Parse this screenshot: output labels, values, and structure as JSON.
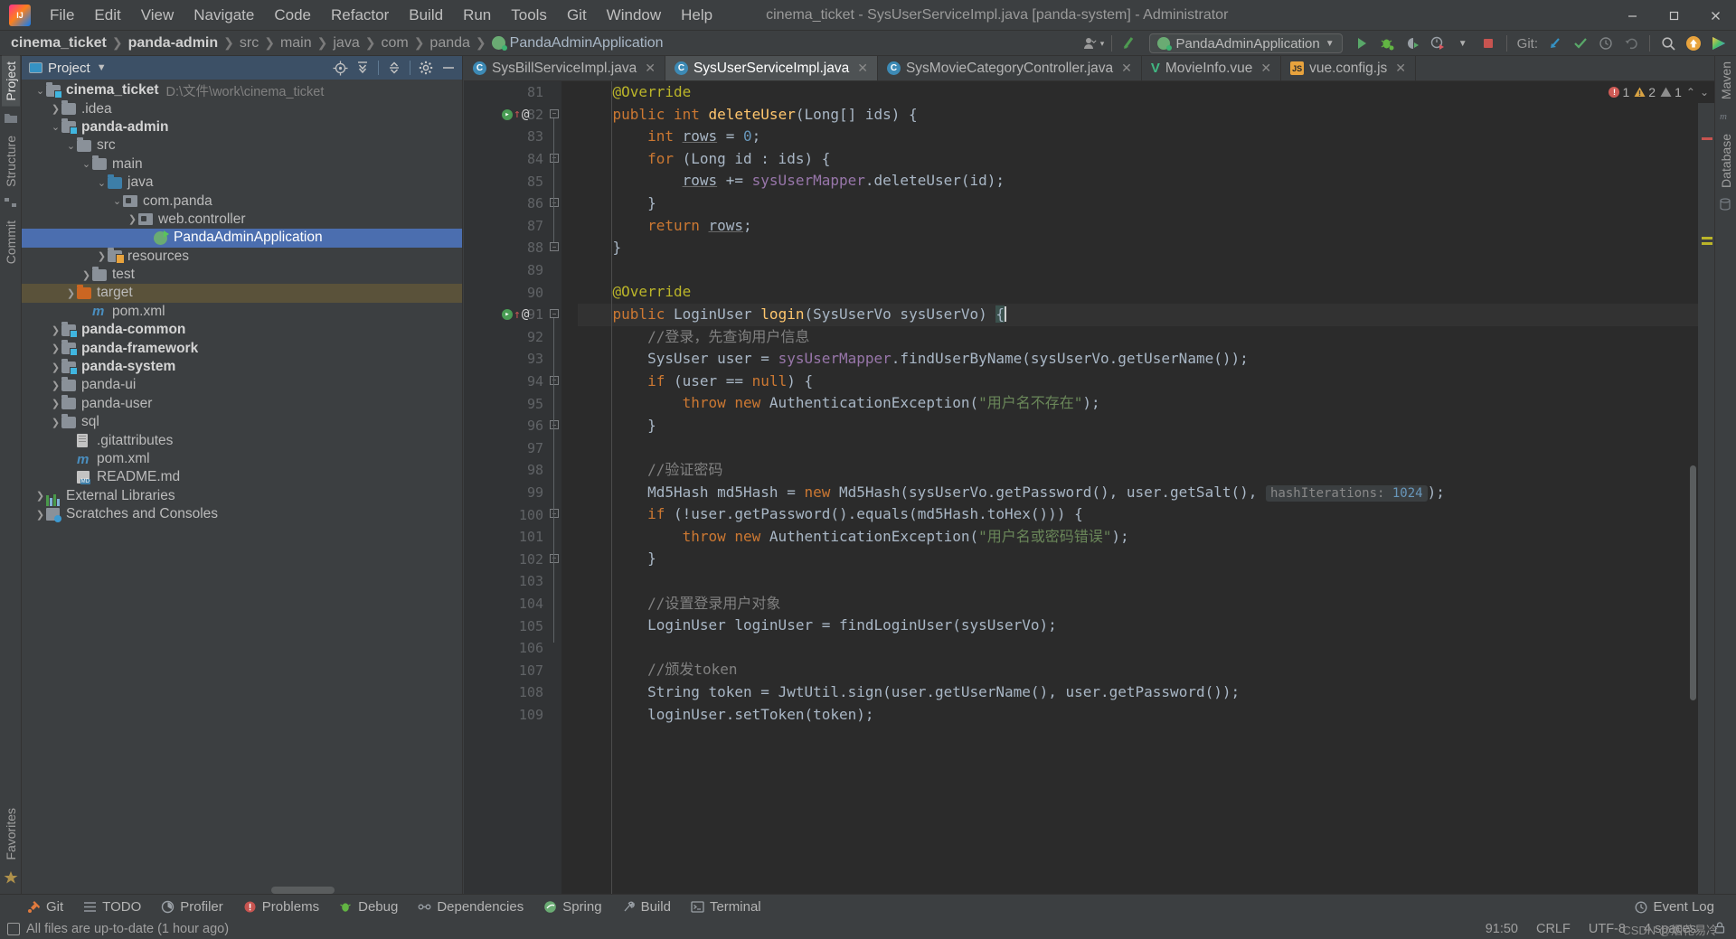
{
  "window": {
    "title": "cinema_ticket - SysUserServiceImpl.java [panda-system] - Administrator",
    "minimize": "—",
    "maximize": "▢",
    "close": "✕"
  },
  "menu": {
    "items": [
      "File",
      "Edit",
      "View",
      "Navigate",
      "Code",
      "Refactor",
      "Build",
      "Run",
      "Tools",
      "Git",
      "Window",
      "Help"
    ]
  },
  "breadcrumb": {
    "items": [
      "cinema_ticket",
      "panda-admin",
      "src",
      "main",
      "java",
      "com",
      "panda",
      "PandaAdminApplication"
    ]
  },
  "toolbar": {
    "run_config": "PandaAdminApplication",
    "git_label": "Git:",
    "icons": [
      "user-icon",
      "updates-icon",
      "run-icon",
      "debug-icon",
      "coverage-icon",
      "profiler-icon",
      "stop-icon",
      "git-pull-icon",
      "git-commit-icon",
      "git-history-icon",
      "git-rollback-icon",
      "search-everywhere-icon",
      "notifications-icon",
      "ide-feature-icon"
    ]
  },
  "left_strip": {
    "tabs": [
      "Project",
      "Structure",
      "Commit"
    ],
    "bottom_tabs": [
      "Favorites"
    ]
  },
  "right_strip": {
    "tabs": [
      "Maven",
      "Database"
    ]
  },
  "project_panel": {
    "title": "Project",
    "actions": [
      "locate-icon",
      "expand-all-icon",
      "collapse-all-icon",
      "settings-gear-icon",
      "hide-icon"
    ],
    "tree": [
      {
        "depth": 0,
        "arrow": "v",
        "icon": "module-folder",
        "label": "cinema_ticket",
        "bold": true,
        "path": "D:\\文件\\work\\cinema_ticket"
      },
      {
        "depth": 1,
        "arrow": ">",
        "icon": "folder",
        "label": ".idea"
      },
      {
        "depth": 1,
        "arrow": "v",
        "icon": "module-folder",
        "label": "panda-admin",
        "bold": true
      },
      {
        "depth": 2,
        "arrow": "v",
        "icon": "folder",
        "label": "src"
      },
      {
        "depth": 3,
        "arrow": "v",
        "icon": "folder",
        "label": "main"
      },
      {
        "depth": 4,
        "arrow": "v",
        "icon": "source-folder",
        "label": "java"
      },
      {
        "depth": 5,
        "arrow": "v",
        "icon": "package",
        "label": "com.panda"
      },
      {
        "depth": 6,
        "arrow": ">",
        "icon": "package",
        "label": "web.controller"
      },
      {
        "depth": 7,
        "arrow": "",
        "icon": "spring-class",
        "label": "PandaAdminApplication",
        "selected": true
      },
      {
        "depth": 4,
        "arrow": ">",
        "icon": "resource-folder",
        "label": "resources"
      },
      {
        "depth": 3,
        "arrow": ">",
        "icon": "folder",
        "label": "test"
      },
      {
        "depth": 2,
        "arrow": ">",
        "icon": "excluded-folder",
        "label": "target",
        "highlight": true
      },
      {
        "depth": 3,
        "arrow": "",
        "icon": "maven",
        "label": "pom.xml"
      },
      {
        "depth": 1,
        "arrow": ">",
        "icon": "module-folder",
        "label": "panda-common",
        "bold": true
      },
      {
        "depth": 1,
        "arrow": ">",
        "icon": "module-folder",
        "label": "panda-framework",
        "bold": true
      },
      {
        "depth": 1,
        "arrow": ">",
        "icon": "module-folder",
        "label": "panda-system",
        "bold": true
      },
      {
        "depth": 1,
        "arrow": ">",
        "icon": "folder",
        "label": "panda-ui"
      },
      {
        "depth": 1,
        "arrow": ">",
        "icon": "folder",
        "label": "panda-user"
      },
      {
        "depth": 1,
        "arrow": ">",
        "icon": "folder",
        "label": "sql"
      },
      {
        "depth": 2,
        "arrow": "",
        "icon": "file",
        "label": ".gitattributes"
      },
      {
        "depth": 2,
        "arrow": "",
        "icon": "maven",
        "label": "pom.xml"
      },
      {
        "depth": 2,
        "arrow": "",
        "icon": "markdown",
        "label": "README.md"
      },
      {
        "depth": 0,
        "arrow": ">",
        "icon": "library",
        "label": "External Libraries"
      },
      {
        "depth": 0,
        "arrow": ">",
        "icon": "scratch",
        "label": "Scratches and Consoles"
      }
    ]
  },
  "editor": {
    "tabs": [
      {
        "label": "SysBillServiceImpl.java",
        "icon": "java-class-icon",
        "active": false
      },
      {
        "label": "SysUserServiceImpl.java",
        "icon": "java-class-icon",
        "active": true
      },
      {
        "label": "SysMovieCategoryController.java",
        "icon": "java-class-icon",
        "active": false
      },
      {
        "label": "MovieInfo.vue",
        "icon": "vue-icon",
        "active": false
      },
      {
        "label": "vue.config.js",
        "icon": "js-icon",
        "active": false
      }
    ],
    "inspection": {
      "errors": "1",
      "warnings": "2",
      "weak": "1"
    },
    "first_line": 81,
    "lines": [
      {
        "n": 81,
        "indent": 1,
        "tokens": [
          {
            "t": "@Override",
            "c": "an"
          }
        ]
      },
      {
        "n": 82,
        "indent": 1,
        "gutter": [
          "green-dot",
          "red-arrow",
          "at"
        ],
        "fold": "open",
        "tokens": [
          {
            "t": "public ",
            "c": "kw"
          },
          {
            "t": "int ",
            "c": "kw"
          },
          {
            "t": "deleteUser",
            "c": "fn"
          },
          {
            "t": "(Long[] ids) {",
            "c": "id"
          }
        ]
      },
      {
        "n": 83,
        "indent": 2,
        "tokens": [
          {
            "t": "int ",
            "c": "kw"
          },
          {
            "t": "rows",
            "c": "id und"
          },
          {
            "t": " = ",
            "c": "id"
          },
          {
            "t": "0",
            "c": "num"
          },
          {
            "t": ";",
            "c": "id"
          }
        ]
      },
      {
        "n": 84,
        "indent": 2,
        "fold": "open",
        "tokens": [
          {
            "t": "for ",
            "c": "kw"
          },
          {
            "t": "(Long id : ids) {",
            "c": "id"
          }
        ]
      },
      {
        "n": 85,
        "indent": 3,
        "tokens": [
          {
            "t": "rows",
            "c": "id und"
          },
          {
            "t": " += ",
            "c": "id"
          },
          {
            "t": "sysUserMapper",
            "c": "fld"
          },
          {
            "t": ".deleteUser(id);",
            "c": "id"
          }
        ]
      },
      {
        "n": 86,
        "indent": 2,
        "fold": "close",
        "tokens": [
          {
            "t": "}",
            "c": "id"
          }
        ]
      },
      {
        "n": 87,
        "indent": 2,
        "tokens": [
          {
            "t": "return ",
            "c": "kw"
          },
          {
            "t": "rows",
            "c": "id und"
          },
          {
            "t": ";",
            "c": "id"
          }
        ]
      },
      {
        "n": 88,
        "indent": 1,
        "fold": "close",
        "tokens": [
          {
            "t": "}",
            "c": "id"
          }
        ]
      },
      {
        "n": 89,
        "indent": 0,
        "tokens": []
      },
      {
        "n": 90,
        "indent": 1,
        "tokens": [
          {
            "t": "@Override",
            "c": "an"
          }
        ]
      },
      {
        "n": 91,
        "indent": 1,
        "current": true,
        "gutter": [
          "green-dot",
          "red-arrow",
          "at"
        ],
        "fold": "open",
        "tokens": [
          {
            "t": "public ",
            "c": "kw"
          },
          {
            "t": "LoginUser ",
            "c": "id"
          },
          {
            "t": "login",
            "c": "fn"
          },
          {
            "t": "(SysUserVo sysUserVo) ",
            "c": "id"
          },
          {
            "t": "{",
            "c": "id brace-hl"
          }
        ]
      },
      {
        "n": 92,
        "indent": 2,
        "tokens": [
          {
            "t": "//登录，先查询用户信息",
            "c": "cm"
          }
        ]
      },
      {
        "n": 93,
        "indent": 2,
        "tokens": [
          {
            "t": "SysUser user = ",
            "c": "id"
          },
          {
            "t": "sysUserMapper",
            "c": "fld"
          },
          {
            "t": ".findUserByName(sysUserVo.getUserName());",
            "c": "id"
          }
        ]
      },
      {
        "n": 94,
        "indent": 2,
        "fold": "open",
        "tokens": [
          {
            "t": "if ",
            "c": "kw"
          },
          {
            "t": "(user == ",
            "c": "id"
          },
          {
            "t": "null",
            "c": "kw"
          },
          {
            "t": ") {",
            "c": "id"
          }
        ]
      },
      {
        "n": 95,
        "indent": 3,
        "tokens": [
          {
            "t": "throw ",
            "c": "kw"
          },
          {
            "t": "new ",
            "c": "kw"
          },
          {
            "t": "AuthenticationException(",
            "c": "id"
          },
          {
            "t": "\"用户名不存在\"",
            "c": "str"
          },
          {
            "t": ");",
            "c": "id"
          }
        ]
      },
      {
        "n": 96,
        "indent": 2,
        "fold": "close",
        "tokens": [
          {
            "t": "}",
            "c": "id"
          }
        ]
      },
      {
        "n": 97,
        "indent": 0,
        "tokens": []
      },
      {
        "n": 98,
        "indent": 2,
        "tokens": [
          {
            "t": "//验证密码",
            "c": "cm"
          }
        ]
      },
      {
        "n": 99,
        "indent": 2,
        "hint": {
          "label": "hashIterations:",
          "value": "1024"
        },
        "tokens": [
          {
            "t": "Md5Hash md5Hash = ",
            "c": "id"
          },
          {
            "t": "new ",
            "c": "kw"
          },
          {
            "t": "Md5Hash(sysUserVo.getPassword(), user.getSalt(), ",
            "c": "id"
          }
        ],
        "tail": [
          {
            "t": ");",
            "c": "id"
          }
        ]
      },
      {
        "n": 100,
        "indent": 2,
        "fold": "open",
        "tokens": [
          {
            "t": "if ",
            "c": "kw"
          },
          {
            "t": "(!user.getPassword().equals(md5Hash.toHex())) {",
            "c": "id"
          }
        ]
      },
      {
        "n": 101,
        "indent": 3,
        "tokens": [
          {
            "t": "throw ",
            "c": "kw"
          },
          {
            "t": "new ",
            "c": "kw"
          },
          {
            "t": "AuthenticationException(",
            "c": "id"
          },
          {
            "t": "\"用户名或密码错误\"",
            "c": "str"
          },
          {
            "t": ");",
            "c": "id"
          }
        ]
      },
      {
        "n": 102,
        "indent": 2,
        "fold": "close",
        "tokens": [
          {
            "t": "}",
            "c": "id"
          }
        ]
      },
      {
        "n": 103,
        "indent": 0,
        "tokens": []
      },
      {
        "n": 104,
        "indent": 2,
        "tokens": [
          {
            "t": "//设置登录用户对象",
            "c": "cm"
          }
        ]
      },
      {
        "n": 105,
        "indent": 2,
        "tokens": [
          {
            "t": "LoginUser loginUser = findLoginUser(sysUserVo);",
            "c": "id"
          }
        ]
      },
      {
        "n": 106,
        "indent": 0,
        "tokens": []
      },
      {
        "n": 107,
        "indent": 2,
        "tokens": [
          {
            "t": "//颁发token",
            "c": "cm"
          }
        ]
      },
      {
        "n": 108,
        "indent": 2,
        "tokens": [
          {
            "t": "String token = ",
            "c": "id"
          },
          {
            "t": "JwtUtil",
            "c": "id"
          },
          {
            "t": ".",
            "c": "id"
          },
          {
            "t": "sign",
            "c": "id"
          },
          {
            "t": "(user.getUserName(), user.getPassword());",
            "c": "id"
          }
        ]
      },
      {
        "n": 109,
        "indent": 2,
        "tokens": [
          {
            "t": "loginUser.setToken(token);",
            "c": "id"
          }
        ]
      }
    ]
  },
  "bottom_bar": {
    "items": [
      {
        "label": "Git",
        "icon": "git-icon"
      },
      {
        "label": "TODO",
        "icon": "todo-icon"
      },
      {
        "label": "Profiler",
        "icon": "profiler-icon"
      },
      {
        "label": "Problems",
        "icon": "problems-icon"
      },
      {
        "label": "Debug",
        "icon": "debug-icon"
      },
      {
        "label": "Dependencies",
        "icon": "dependencies-icon"
      },
      {
        "label": "Spring",
        "icon": "spring-icon"
      },
      {
        "label": "Build",
        "icon": "build-icon"
      },
      {
        "label": "Terminal",
        "icon": "terminal-icon"
      }
    ],
    "event_log": "Event Log"
  },
  "status_bar": {
    "message": "All files are up-to-date (1 hour ago)",
    "caret": "91:50",
    "line_sep": "CRLF",
    "encoding": "UTF-8",
    "indent": "4 spaces",
    "lock": "lock-icon",
    "toast": "CSDN @烟花易冷"
  },
  "colors": {
    "accent_blue": "#4b6eaf",
    "panel_bg": "#3c3f41",
    "editor_bg": "#2b2b2b",
    "gutter_bg": "#313335",
    "keyword": "#cc7832",
    "string": "#6a8759",
    "comment": "#808080",
    "number": "#6897bb",
    "field": "#9876aa",
    "method": "#ffc66d",
    "annotation": "#bbb529"
  }
}
